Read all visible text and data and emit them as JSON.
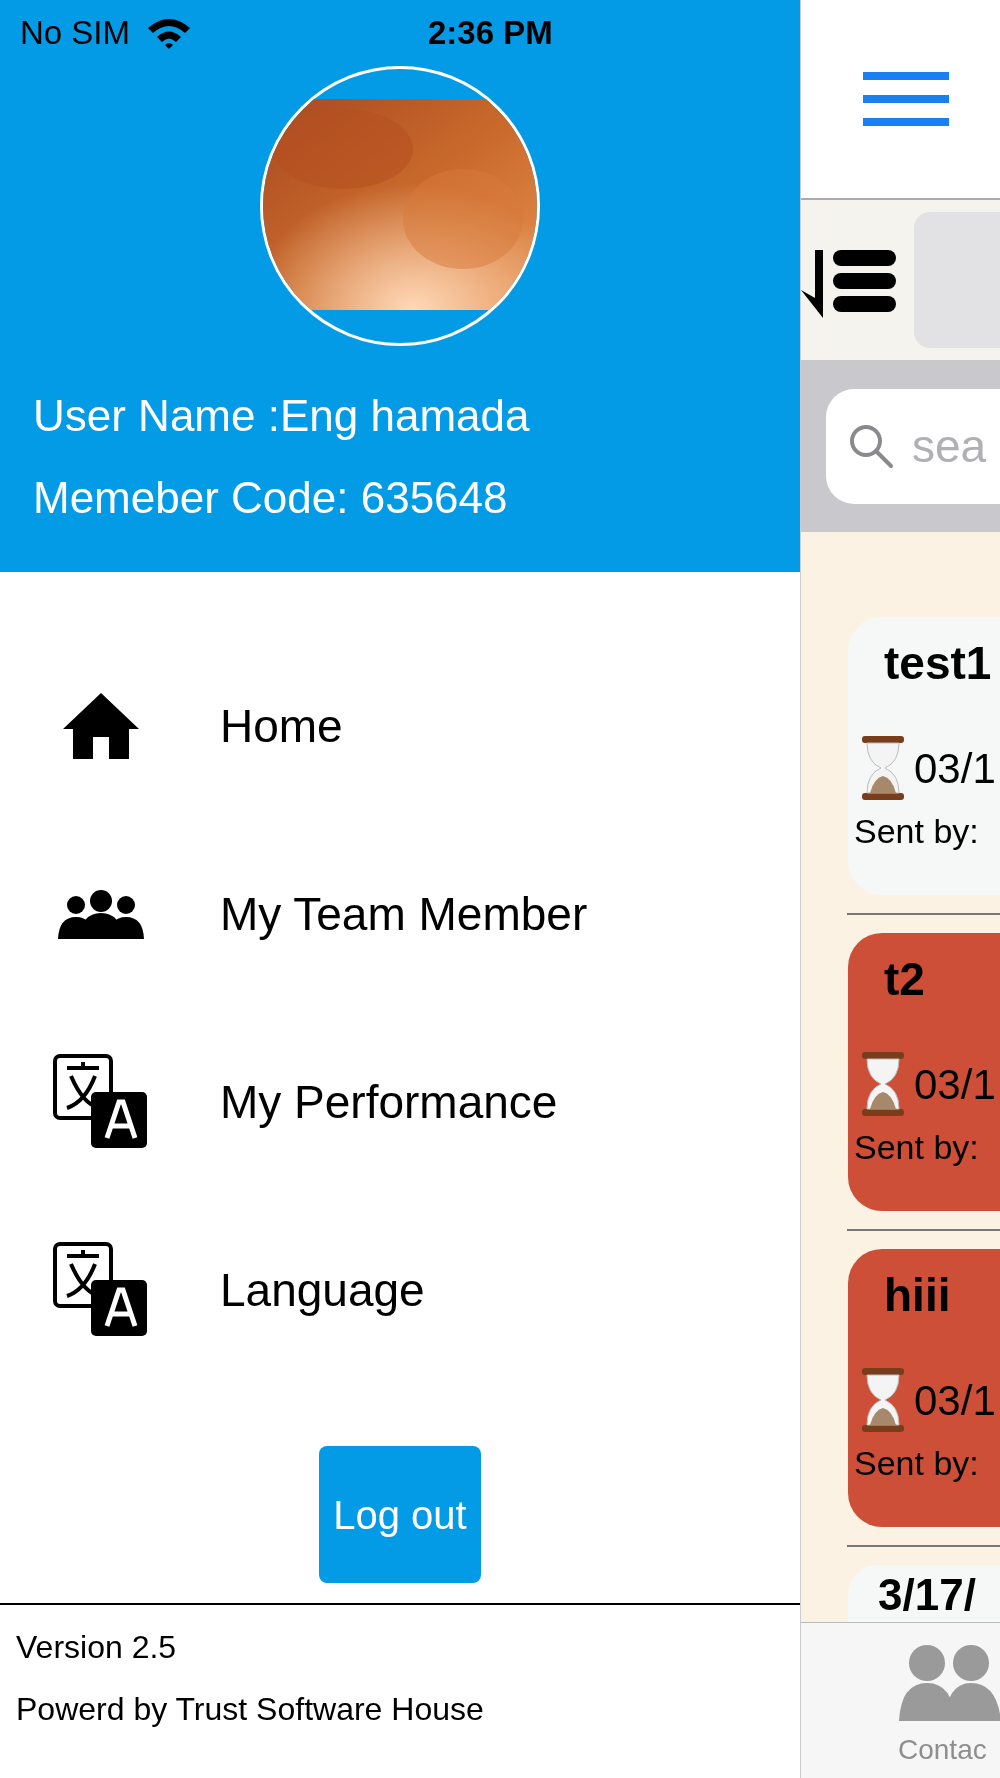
{
  "status_bar": {
    "carrier": "No SIM",
    "time": "2:36 PM"
  },
  "drawer": {
    "user_name": "User Name :Eng hamada",
    "member_code": "Memeber Code: 635648",
    "menu": [
      {
        "label": "Home",
        "kind": "home"
      },
      {
        "label": "My Team Member",
        "kind": "team"
      },
      {
        "label": "My Performance",
        "kind": "translate"
      },
      {
        "label": "Language",
        "kind": "translate"
      }
    ],
    "logout_button": "Log out",
    "version": "Version 2.5",
    "powered_by": "Powerd by Trust Software House"
  },
  "background_screen": {
    "search": {
      "placeholder": "sea"
    },
    "messages": [
      {
        "title": "test1",
        "date": "03/1",
        "sender_label": "Sent by:",
        "color": "#f6f8f8"
      },
      {
        "title": "t2",
        "date": "03/1",
        "sender_label": "Sent by:",
        "color": "#cd4f37"
      },
      {
        "title": "hiii",
        "date": "03/1",
        "sender_label": "Sent by:",
        "color": "#cd4f37"
      }
    ],
    "partial_item": "3/17/",
    "tab_bar": {
      "label": "Contac"
    }
  }
}
